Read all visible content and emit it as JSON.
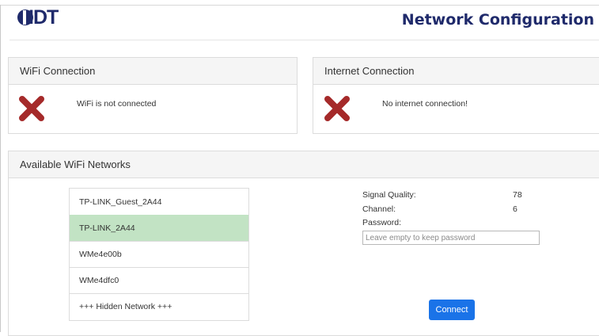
{
  "header": {
    "logo_text": "IDT",
    "title": "Network Configuration"
  },
  "wifi_panel": {
    "title": "WiFi Connection",
    "status_icon": "x-icon",
    "status_text": "WiFi is not connected"
  },
  "internet_panel": {
    "title": "Internet Connection",
    "status_icon": "x-icon",
    "status_text": "No internet connection!"
  },
  "networks_panel": {
    "title": "Available WiFi Networks",
    "networks": [
      {
        "ssid": "TP-LINK_Guest_2A44",
        "selected": false
      },
      {
        "ssid": "TP-LINK_2A44",
        "selected": true
      },
      {
        "ssid": "WMe4e00b",
        "selected": false
      },
      {
        "ssid": "WMe4dfc0",
        "selected": false
      },
      {
        "ssid": "+++ Hidden Network +++",
        "selected": false
      }
    ],
    "details": {
      "signal_label": "Signal Quality:",
      "signal_value": "78",
      "channel_label": "Channel:",
      "channel_value": "6",
      "password_label": "Password:",
      "password_value": "",
      "password_placeholder": "Leave empty to keep password"
    },
    "connect_label": "Connect"
  },
  "colors": {
    "brand": "#1f2a6b",
    "error": "#a52a2a",
    "selected_row": "#c2e3c4",
    "button": "#1a73e8"
  }
}
